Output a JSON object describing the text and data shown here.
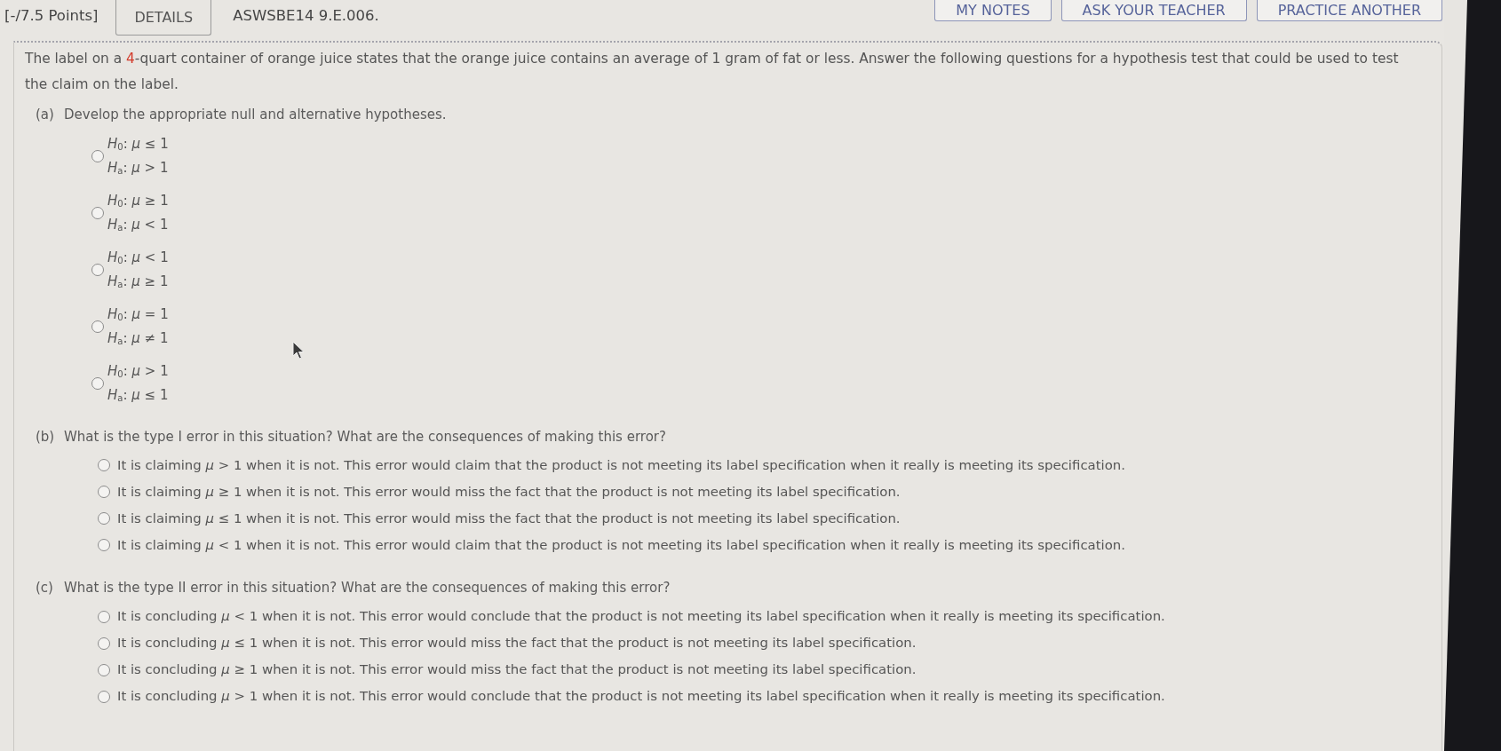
{
  "header": {
    "points": "[-/7.5 Points]",
    "details_button": "DETAILS",
    "problem_id": "ASWSBE14 9.E.006.",
    "buttons": [
      "MY NOTES",
      "ASK YOUR TEACHER",
      "PRACTICE ANOTHER"
    ]
  },
  "question": {
    "segments": [
      {
        "kind": "text",
        "text": "The label on a "
      },
      {
        "kind": "value",
        "text": "4"
      },
      {
        "kind": "text",
        "text": "-quart container of orange juice states that the orange juice contains an average of 1 gram of fat or less. Answer the following questions for a hypothesis test that could be used to test the claim on the label."
      }
    ]
  },
  "parts": [
    {
      "letter": "(a)",
      "prompt": "Develop the appropriate null and alternative hypotheses.",
      "kind": "hypotheses",
      "options": [
        {
          "lines": [
            "*H*$_{0}$: *μ* ≤ 1",
            "*H*$_{a}$: *μ* > 1"
          ],
          "selected": false
        },
        {
          "lines": [
            "*H*$_{0}$: *μ* ≥ 1",
            "*H*$_{a}$: *μ* < 1"
          ],
          "selected": false
        },
        {
          "lines": [
            "*H*$_{0}$: *μ* < 1",
            "*H*$_{a}$: *μ* ≥ 1"
          ],
          "selected": false
        },
        {
          "lines": [
            "*H*$_{0}$: *μ* = 1",
            "*H*$_{a}$: *μ* ≠ 1"
          ],
          "selected": false
        },
        {
          "lines": [
            "*H*$_{0}$: *μ* > 1",
            "*H*$_{a}$: *μ* ≤ 1"
          ],
          "selected": false
        }
      ]
    },
    {
      "letter": "(b)",
      "prompt": "What is the type I error in this situation? What are the consequences of making this error?",
      "kind": "statements",
      "options": [
        {
          "text": "It is claiming *μ* > 1 when it is not. This error would claim that the product is not meeting its label specification when it really is meeting its specification.",
          "selected": false
        },
        {
          "text": "It is claiming *μ* ≥ 1 when it is not. This error would miss the fact that the product is not meeting its label specification.",
          "selected": false
        },
        {
          "text": "It is claiming *μ* ≤ 1 when it is not. This error would miss the fact that the product is not meeting its label specification.",
          "selected": false
        },
        {
          "text": "It is claiming *μ* < 1 when it is not. This error would claim that the product is not meeting its label specification when it really is meeting its specification.",
          "selected": false
        }
      ]
    },
    {
      "letter": "(c)",
      "prompt": "What is the type II error in this situation? What are the consequences of making this error?",
      "kind": "statements",
      "options": [
        {
          "text": "It is concluding *μ* < 1 when it is not. This error would conclude that the product is not meeting its label specification when it really is meeting its specification.",
          "selected": false
        },
        {
          "text": "It is concluding *μ* ≤ 1 when it is not. This error would miss the fact that the product is not meeting its label specification.",
          "selected": false
        },
        {
          "text": "It is concluding *μ* ≥ 1 when it is not. This error would miss the fact that the product is not meeting its label specification.",
          "selected": false
        },
        {
          "text": "It is concluding *μ* > 1 when it is not. This error would conclude that the product is not meeting its label specification when it really is meeting its specification.",
          "selected": false
        }
      ]
    }
  ]
}
